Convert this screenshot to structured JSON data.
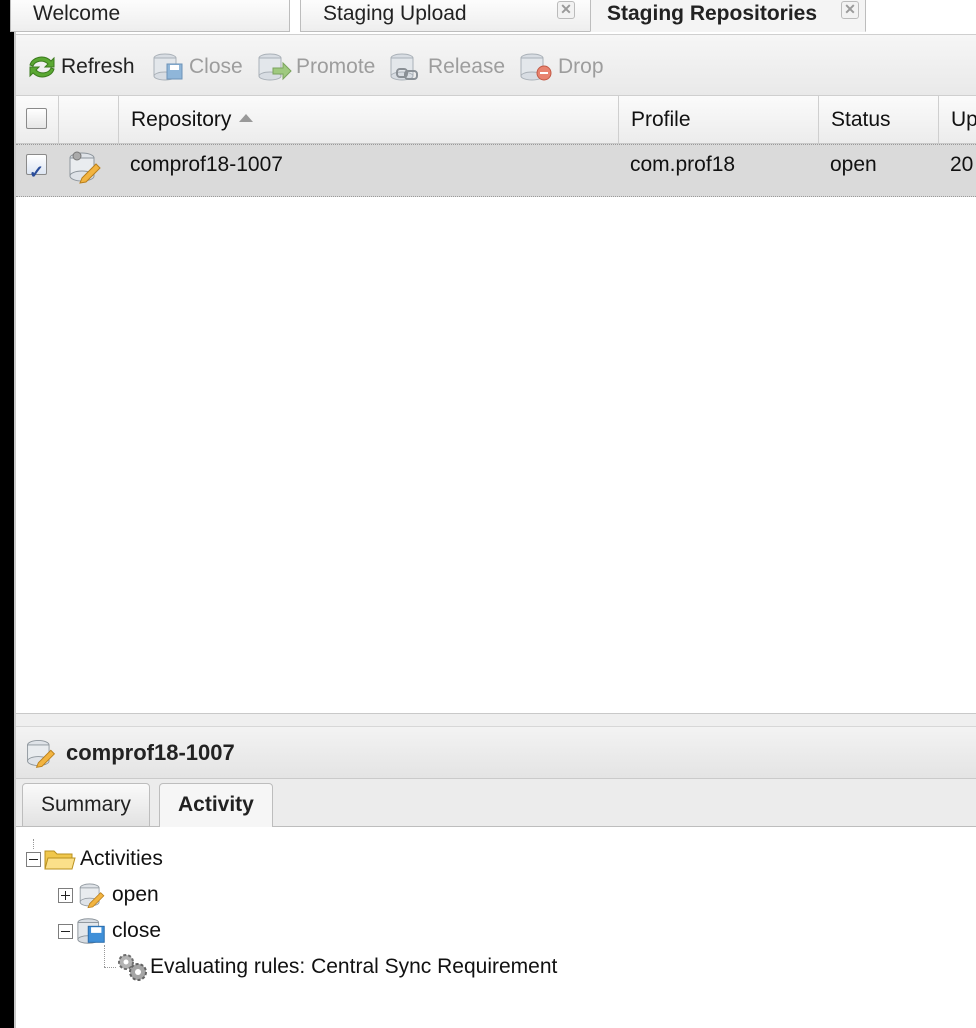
{
  "tabs": [
    {
      "label": "Welcome",
      "closable": false,
      "active": false
    },
    {
      "label": "Staging Upload",
      "closable": true,
      "active": false
    },
    {
      "label": "Staging Repositories",
      "closable": true,
      "active": true
    }
  ],
  "toolbar": {
    "refresh": "Refresh",
    "close": "Close",
    "promote": "Promote",
    "release": "Release",
    "drop": "Drop"
  },
  "grid": {
    "columns": {
      "repository": "Repository",
      "profile": "Profile",
      "status": "Status",
      "updated": "Updated"
    },
    "sort_column": "Repository",
    "sort_direction": "ascending",
    "rows": [
      {
        "checked": true,
        "repository": "comprof18-1007",
        "profile": "com.prof18",
        "status": "open",
        "updated": "20"
      }
    ]
  },
  "detail": {
    "title": "comprof18-1007",
    "tabs": {
      "summary": "Summary",
      "activity": "Activity"
    },
    "active_tab": "Activity"
  },
  "activity_tree": {
    "root": "Activities",
    "open": "open",
    "close": "close",
    "rule": "Evaluating rules: Central Sync Requirement"
  },
  "colors": {
    "selected_row": "#dadada",
    "refresh_icon": "#4c9a2a",
    "disabled_text": "#9d9d9d"
  }
}
